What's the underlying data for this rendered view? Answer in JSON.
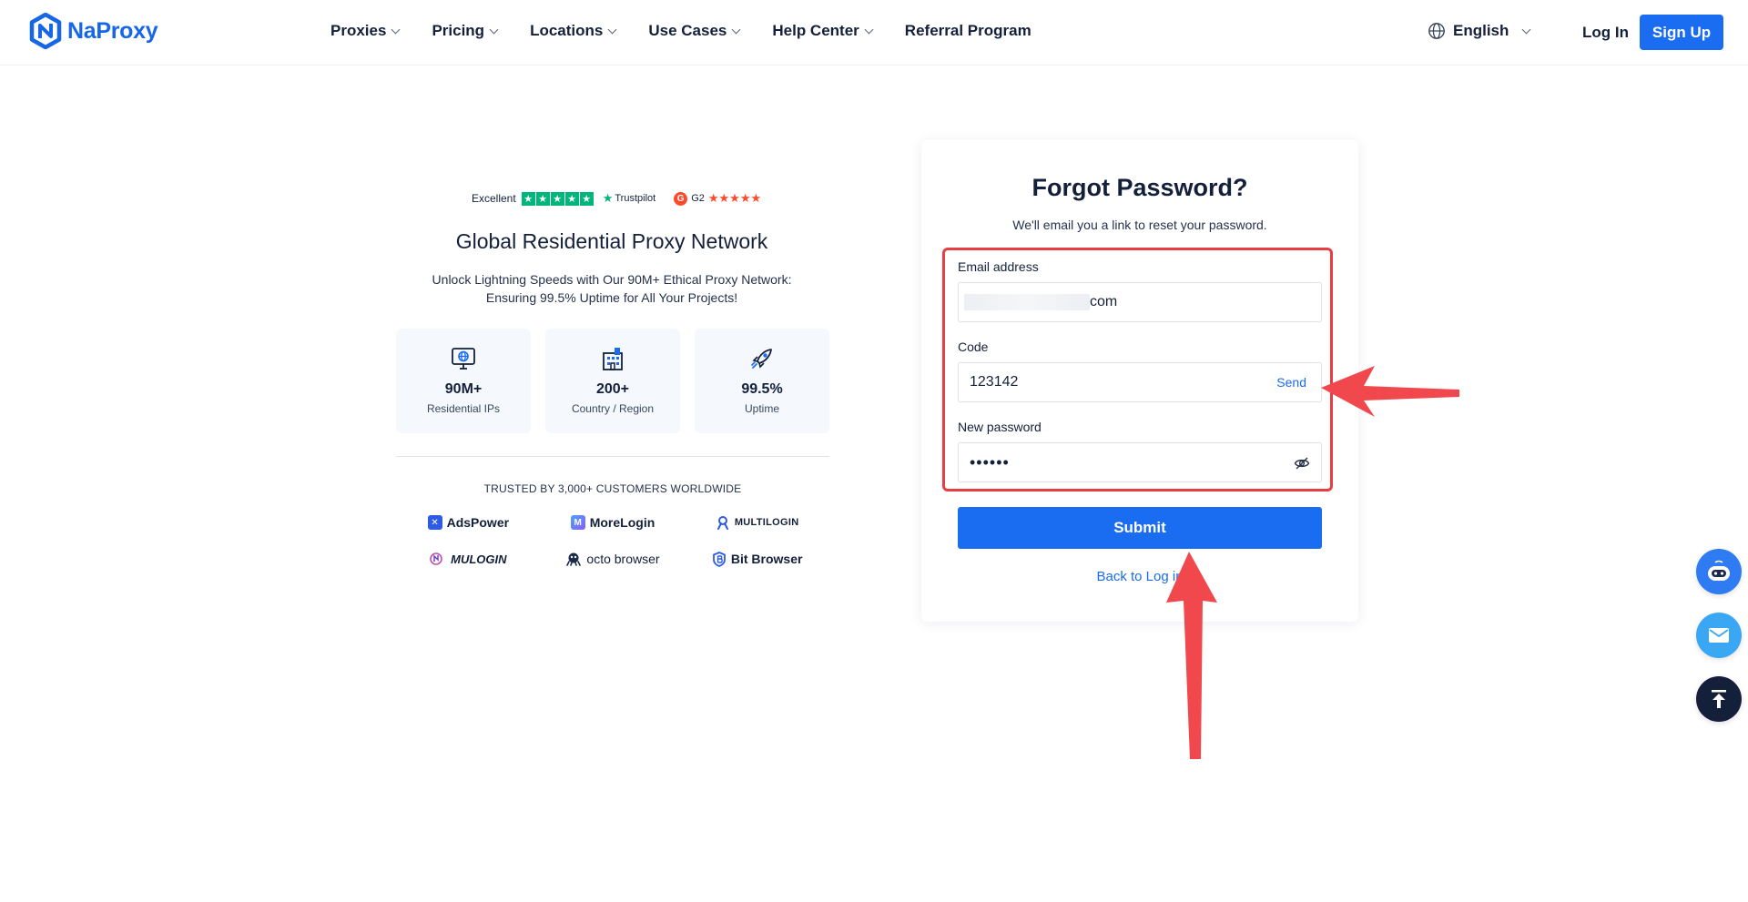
{
  "header": {
    "brand": "NaProxy",
    "nav": [
      {
        "label": "Proxies",
        "has_dropdown": true
      },
      {
        "label": "Pricing",
        "has_dropdown": true
      },
      {
        "label": "Locations",
        "has_dropdown": true
      },
      {
        "label": "Use Cases",
        "has_dropdown": true
      },
      {
        "label": "Help Center",
        "has_dropdown": true
      },
      {
        "label": "Referral Program",
        "has_dropdown": false
      }
    ],
    "language": "English",
    "login": "Log In",
    "signup": "Sign Up"
  },
  "info": {
    "rating_label": "Excellent",
    "trustpilot": "Trustpilot",
    "g2": "G2",
    "title": "Global Residential Proxy Network",
    "subtitle_line1": "Unlock Lightning Speeds with Our 90M+ Ethical Proxy Network:",
    "subtitle_line2": "Ensuring 99.5% Uptime for All Your Projects!",
    "stats": [
      {
        "value": "90M+",
        "label": "Residential IPs",
        "icon": "monitor-globe-icon"
      },
      {
        "value": "200+",
        "label": "Country / Region",
        "icon": "building-icon"
      },
      {
        "value": "99.5%",
        "label": "Uptime",
        "icon": "rocket-icon"
      }
    ],
    "trusted_text": "TRUSTED BY 3,000+ CUSTOMERS WORLDWIDE",
    "brands": [
      "AdsPower",
      "MoreLogin",
      "MULTILOGIN",
      "MULOGIN",
      "octo browser",
      "Bit Browser"
    ]
  },
  "form": {
    "title": "Forgot Password?",
    "subtitle": "We'll email you a link to reset your password.",
    "email_label": "Email address",
    "email_value_suffix": "com",
    "code_label": "Code",
    "code_value": "123142",
    "send_label": "Send",
    "password_label": "New password",
    "password_mask": "••••••",
    "submit_label": "Submit",
    "back_label": "Back to Log in"
  },
  "colors": {
    "primary": "#1a6cf0",
    "text": "#14203a",
    "annotation_red": "#e53f44"
  }
}
